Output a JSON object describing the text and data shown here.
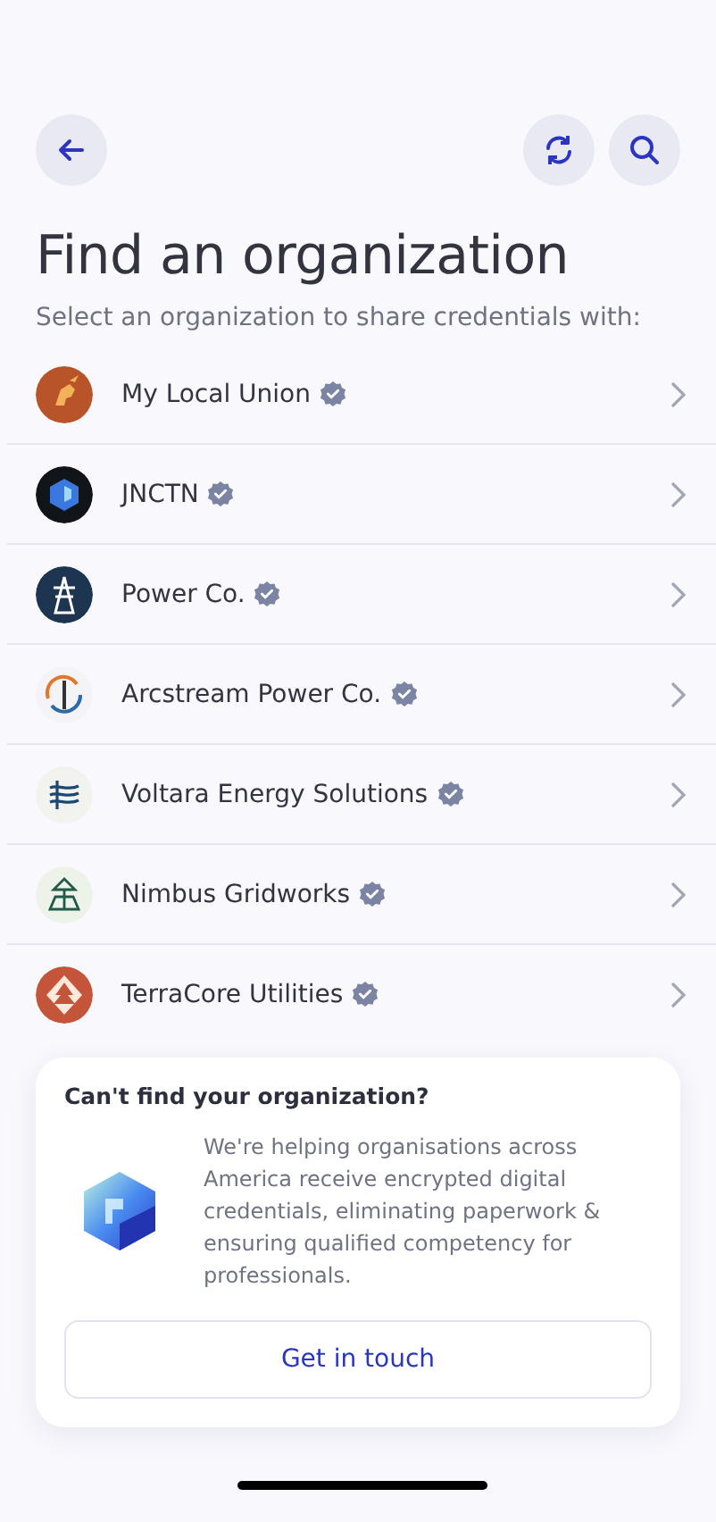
{
  "title": "Find an organization",
  "subtitle": "Select an organization to share credentials with:",
  "organizations": [
    {
      "name": "My Local Union",
      "verified": true,
      "color": "#b8532a"
    },
    {
      "name": "JNCTN",
      "verified": true,
      "color": "#111418"
    },
    {
      "name": "Power Co.",
      "verified": true,
      "color": "#1d3550"
    },
    {
      "name": "Arcstream Power Co.",
      "verified": true,
      "color": "#f4f4f6"
    },
    {
      "name": "Voltara Energy Solutions",
      "verified": true,
      "color": "#f2f3ee"
    },
    {
      "name": "Nimbus Gridworks",
      "verified": true,
      "color": "#eef3ea"
    },
    {
      "name": "TerraCore Utilities",
      "verified": true,
      "color": "#c4553a"
    }
  ],
  "help_card": {
    "heading": "Can't find your organization?",
    "body": "We're helping organisations across America receive encrypted digital credentials, eliminating paperwork & ensuring qualified competency for professionals.",
    "button": "Get in touch"
  }
}
